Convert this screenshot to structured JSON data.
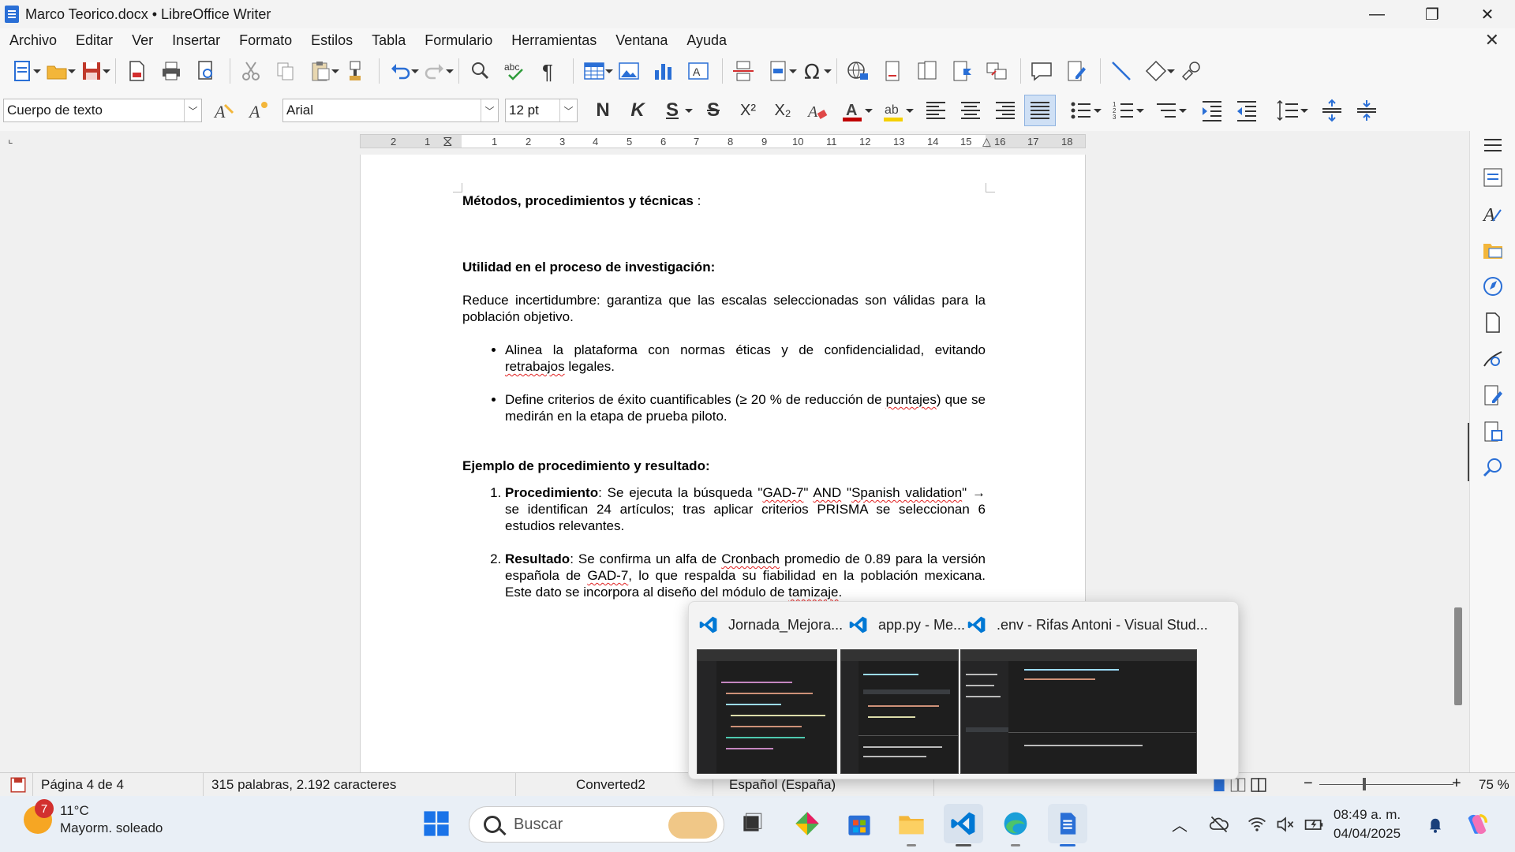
{
  "window": {
    "title": "Marco Teorico.docx • LibreOffice Writer",
    "minimize": "—",
    "restore": "❐",
    "close": "✕"
  },
  "menu": {
    "items": [
      "Archivo",
      "Editar",
      "Ver",
      "Insertar",
      "Formato",
      "Estilos",
      "Tabla",
      "Formulario",
      "Herramientas",
      "Ventana",
      "Ayuda"
    ],
    "close_doc": "✕"
  },
  "format_bar": {
    "paragraph_style": "Cuerpo de texto",
    "font_name": "Arial",
    "font_size": "12 pt",
    "bold": "N",
    "italic": "K",
    "underline": "S",
    "strike": "S",
    "superscript": "X²",
    "subscript": "X₂"
  },
  "ruler": {
    "ticks": [
      "2",
      "1",
      "1",
      "2",
      "3",
      "4",
      "5",
      "6",
      "7",
      "8",
      "9",
      "10",
      "11",
      "12",
      "13",
      "14",
      "15",
      "16",
      "17",
      "18"
    ]
  },
  "document": {
    "heading1_bold": "Métodos, procedimientos y técnicas",
    "heading1_tail": " :",
    "heading2": "Utilidad en el proceso de investigación:",
    "para1": "Reduce incertidumbre: garantiza que las escalas seleccionadas son válidas para la población objetivo.",
    "bullet1_a": "Alinea la plataforma con normas éticas y de confidencialidad, evitando ",
    "bullet1_spell": "retrabajos",
    "bullet1_b": " legales.",
    "bullet2_a": "Define criterios de éxito cuantificables (≥ 20 % de reducción de ",
    "bullet2_spell": "puntajes",
    "bullet2_b": ") que se medirán en la etapa de prueba piloto.",
    "heading3": "Ejemplo de procedimiento y resultado:",
    "item1_label": "Procedimiento",
    "item1_a": ": Se ejecuta la búsqueda \"",
    "item1_spell1": "GAD-7",
    "item1_b": "\" ",
    "item1_spell2": "AND",
    "item1_c": " \"",
    "item1_spell3": "Spanish validation",
    "item1_d": "\" → se identifican 24 artículos; tras aplicar criterios PRISMA se seleccionan 6 estudios relevantes.",
    "item2_label": "Resultado",
    "item2_a": ": Se confirma un alfa de ",
    "item2_spell1": "Cronbach",
    "item2_b": " promedio de 0.89 para la versión española de ",
    "item2_spell2": "GAD-7",
    "item2_c": ", lo que respalda su fiabilidad en la población mexicana. Este dato se incorpora al diseño del módulo de ",
    "item2_spell3": "tamizaje",
    "item2_d": "."
  },
  "status": {
    "page": "Página 4 de 4",
    "words": "315 palabras, 2.192 caracteres",
    "style": "Converted2",
    "language": "Español (España)",
    "zoom": "75 %"
  },
  "taskbar": {
    "weather_badge": "7",
    "temperature": "11°C",
    "weather_desc": "Mayorm. soleado",
    "search_placeholder": "Buscar",
    "time": "08:49 a. m.",
    "date": "04/04/2025"
  },
  "popup": {
    "windows": [
      {
        "title": "Jornada_Mejora..."
      },
      {
        "title": "app.py - Me..."
      },
      {
        "title": ".env - Rifas Antoni - Visual Stud..."
      }
    ]
  },
  "colors": {
    "accent": "#2a6fd6",
    "vscode": "#0078d4",
    "spell_error": "#e02020",
    "font_color_bar": "#c00000",
    "highlight_bar": "#f5d000"
  }
}
